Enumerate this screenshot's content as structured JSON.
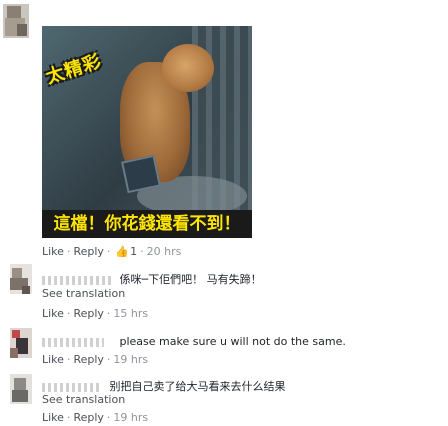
{
  "post": {
    "meme_title": "太精彩",
    "meme_banner": "這檔！你花錢還看不到！",
    "actions": {
      "like": "Like",
      "reply": "Reply",
      "like_count": "1",
      "time": "20 hrs"
    }
  },
  "comments": [
    {
      "text": "係咪─下佢們吧！ 马有失蹄！",
      "see_translation": "See translation",
      "like": "Like",
      "reply": "Reply",
      "time": "15 hrs"
    },
    {
      "text": "please make sure u will not do the same.",
      "like": "Like",
      "reply": "Reply",
      "time": "19 hrs"
    },
    {
      "text": "别把自己卖了给大马看来去什么结果",
      "see_translation": "See translation",
      "like": "Like",
      "reply": "Reply",
      "time": "19 hrs"
    }
  ],
  "icons": {
    "like": "thumbs-up-icon"
  },
  "colors": {
    "accent_yellow": "#ffe600",
    "link_gray": "#4b4f56",
    "meta_gray": "#90949c"
  }
}
